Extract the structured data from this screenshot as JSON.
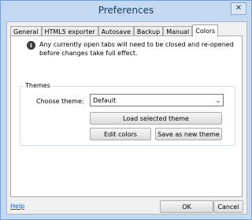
{
  "window": {
    "title": "Preferences",
    "close_glyph": "✕"
  },
  "tabs": [
    {
      "label": "General",
      "active": false
    },
    {
      "label": "HTML5 exporter",
      "active": false
    },
    {
      "label": "Autosave",
      "active": false
    },
    {
      "label": "Backup",
      "active": false
    },
    {
      "label": "Manual",
      "active": false
    },
    {
      "label": "Colors",
      "active": true
    }
  ],
  "colors_tab": {
    "info_icon": "i",
    "notice": "Any currently open tabs will need to be closed and re-opened before changes take full effect.",
    "themes_group_label": "Themes",
    "choose_theme_label": "Choose theme:",
    "theme_value": "Default",
    "theme_dropdown_glyph": "⌄",
    "load_button": "Load selected theme",
    "edit_button": "Edit colors",
    "save_button": "Save as new theme"
  },
  "footer": {
    "help_link": "Help",
    "ok_button": "OK",
    "cancel_button": "Cancel"
  },
  "icons": {
    "info": "info-icon",
    "close": "close-icon",
    "dropdown": "chevron-down-icon"
  }
}
